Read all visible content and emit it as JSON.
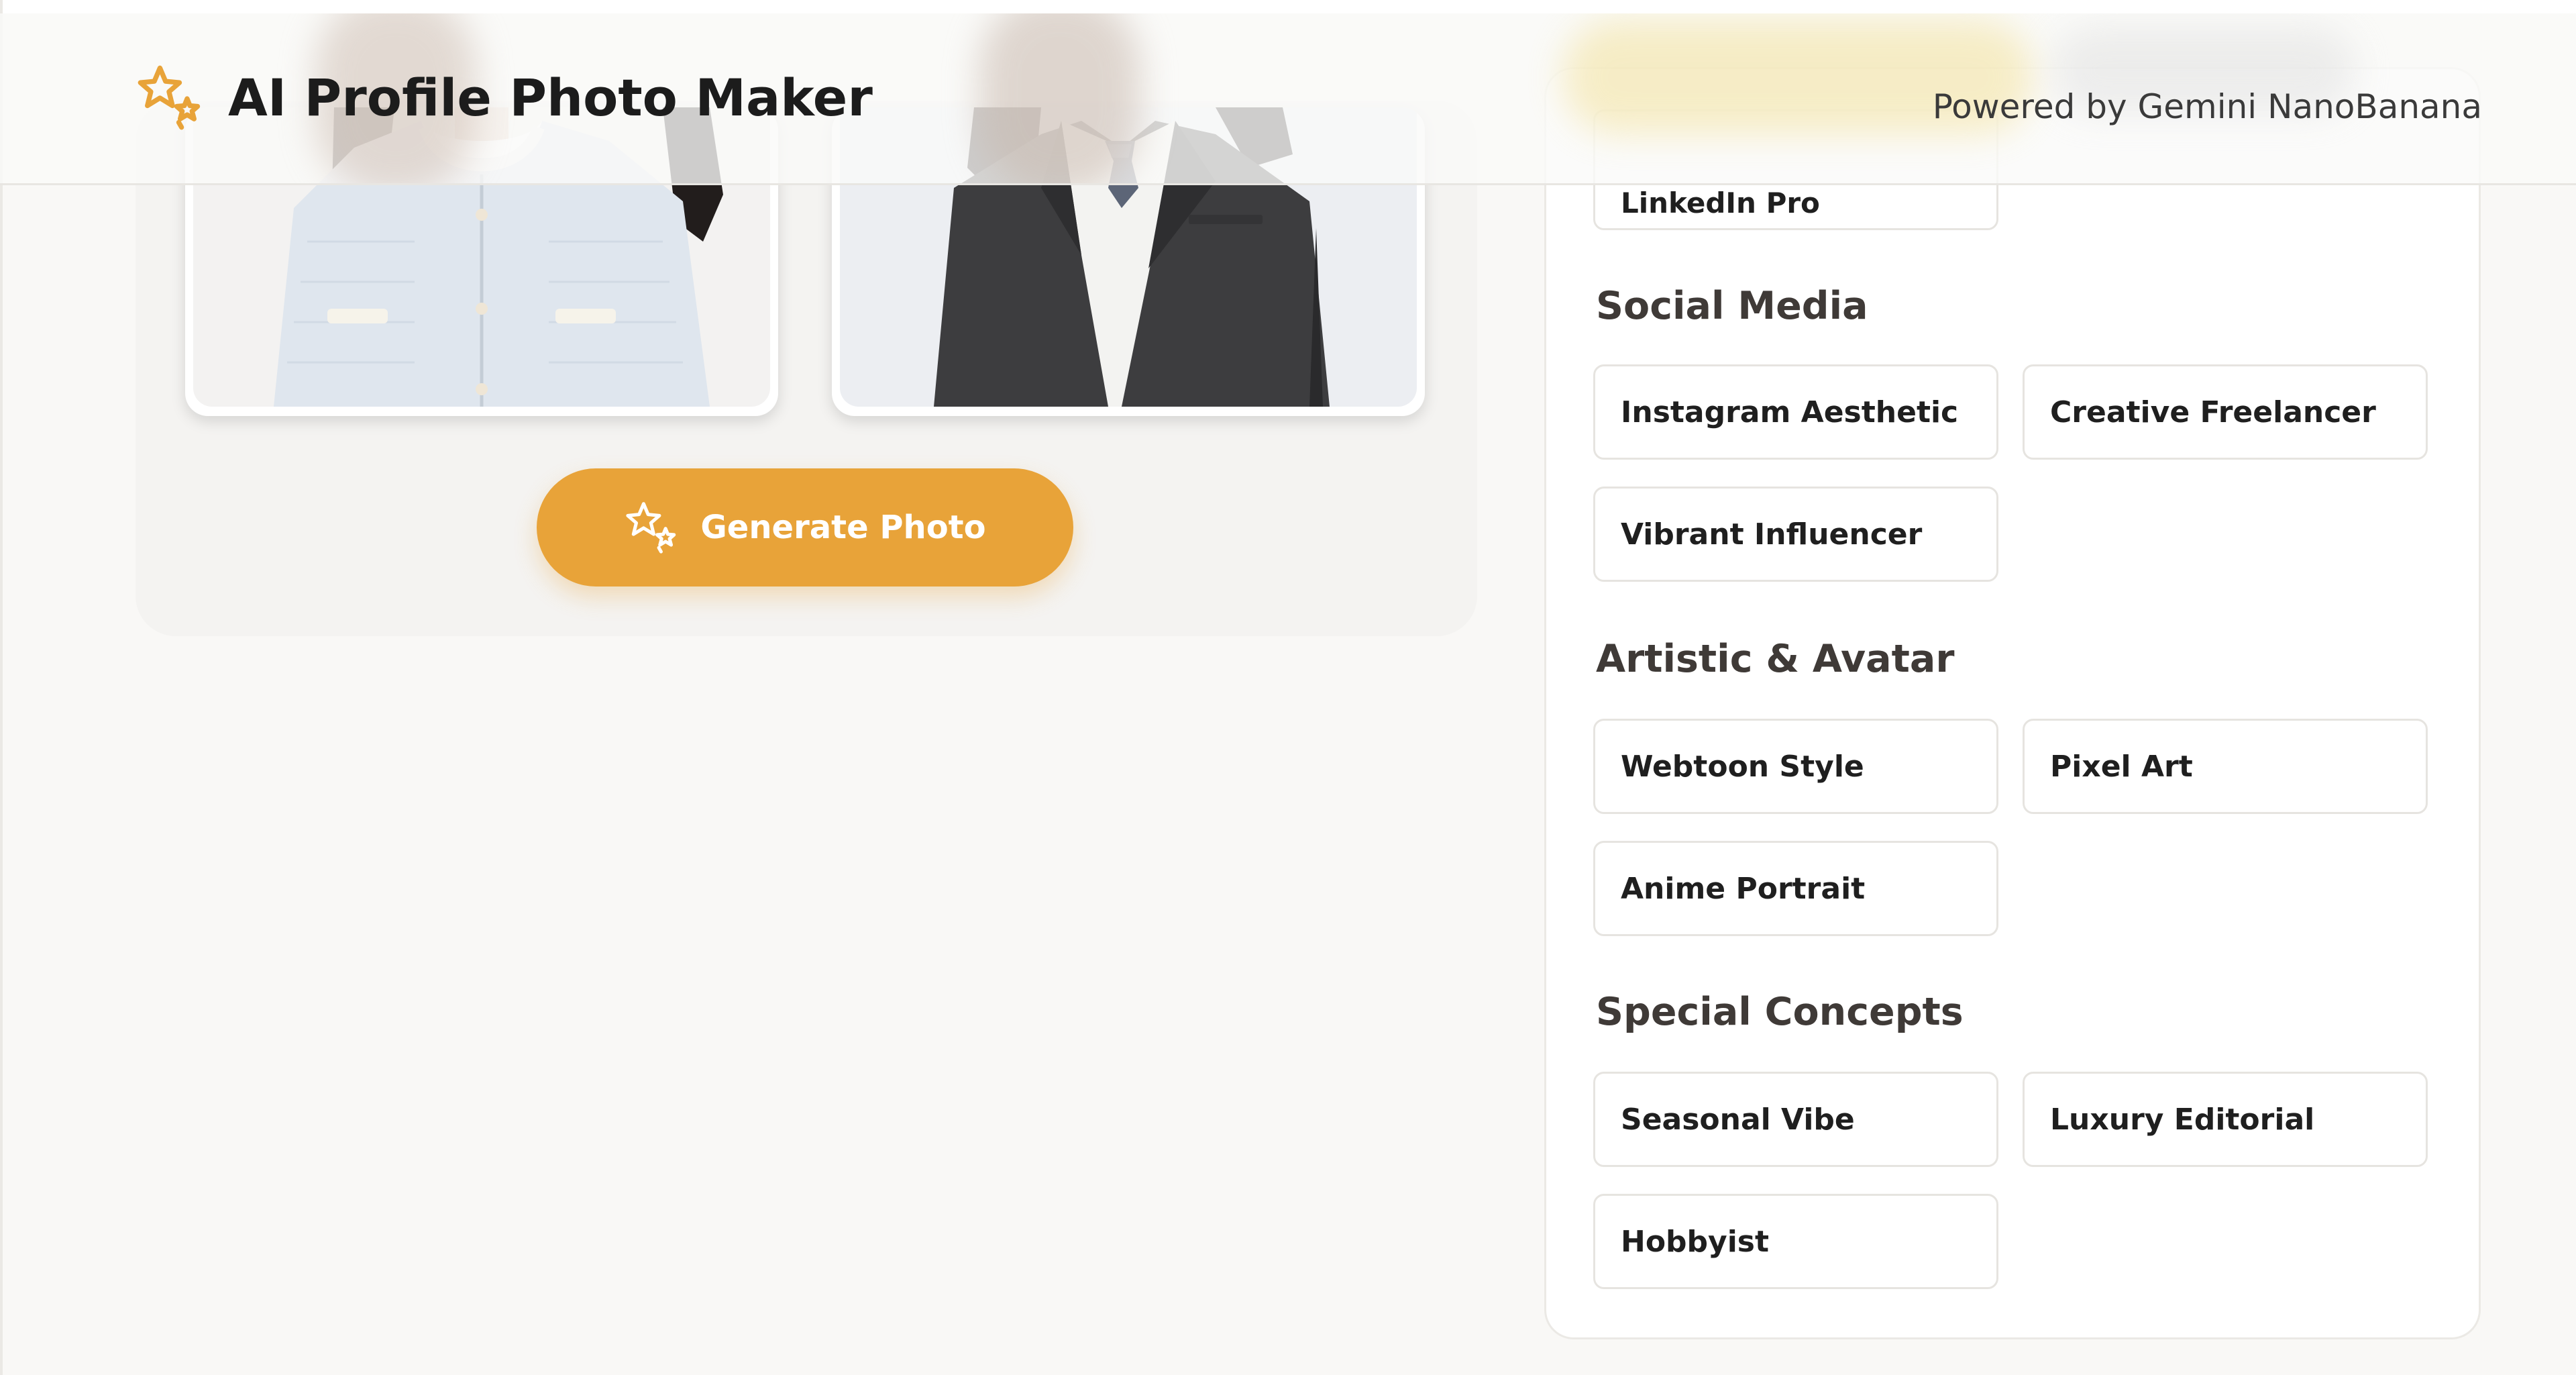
{
  "header": {
    "app_title": "AI Profile Photo Maker",
    "powered_by": "Powered by Gemini NanoBanana",
    "logo_icon": "sparkle-stars-icon"
  },
  "photos": {
    "items": [
      {
        "subject": "woman in light tweed cardigan"
      },
      {
        "subject": "woman in dark suit with tie"
      }
    ]
  },
  "actions": {
    "generate_label": "Generate Photo",
    "generate_icon": "sparkle-stars-icon"
  },
  "styles": {
    "partial_item": "LinkedIn Pro",
    "sections": [
      {
        "title": "Social Media",
        "items": [
          "Instagram Aesthetic",
          "Creative Freelancer",
          "Vibrant Influencer"
        ]
      },
      {
        "title": "Artistic & Avatar",
        "items": [
          "Webtoon Style",
          "Pixel Art",
          "Anime Portrait"
        ]
      },
      {
        "title": "Special Concepts",
        "items": [
          "Seasonal Vibe",
          "Luxury Editorial",
          "Hobbyist"
        ]
      }
    ]
  },
  "colors": {
    "accent": "#e8a339",
    "background": "#f9f8f6",
    "card": "#f4f3f1",
    "border": "#e6e4e0"
  }
}
